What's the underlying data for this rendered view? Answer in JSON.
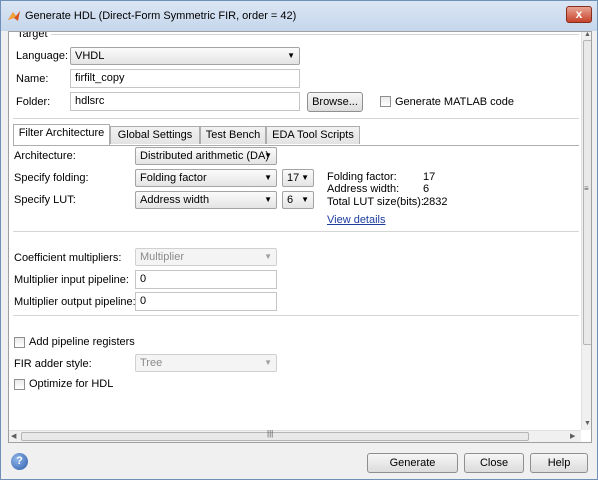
{
  "window": {
    "title": "Generate HDL (Direct-Form Symmetric FIR, order = 42)",
    "close_glyph": "x"
  },
  "target": {
    "group_title": "Target",
    "language_label": "Language:",
    "language_value": "VHDL",
    "name_label": "Name:",
    "name_value": "firfilt_copy",
    "folder_label": "Folder:",
    "folder_value": "hdlsrc",
    "browse_label": "Browse...",
    "generate_matlab_label": "Generate MATLAB code"
  },
  "tabs": [
    {
      "label": "Filter Architecture"
    },
    {
      "label": "Global Settings"
    },
    {
      "label": "Test Bench"
    },
    {
      "label": "EDA Tool Scripts"
    }
  ],
  "architecture": {
    "architecture_label": "Architecture:",
    "architecture_value": "Distributed arithmetic (DA)",
    "folding_label": "Specify folding:",
    "folding_value": "Folding factor",
    "folding_number": "17",
    "lut_label": "Specify LUT:",
    "lut_value": "Address width",
    "lut_number": "6",
    "info_folding_label": "Folding factor:",
    "info_folding_value": "17",
    "info_address_label": "Address width:",
    "info_address_value": "6",
    "info_lut_label": "Total LUT size(bits):",
    "info_lut_value": "2832",
    "view_details": "View details"
  },
  "multipliers": {
    "coeff_label": "Coefficient multipliers:",
    "coeff_value": "Multiplier",
    "input_pipeline_label": "Multiplier input pipeline:",
    "input_pipeline_value": "0",
    "output_pipeline_label": "Multiplier output pipeline:",
    "output_pipeline_value": "0"
  },
  "pipeline": {
    "add_pipeline_label": "Add pipeline registers",
    "adder_style_label": "FIR adder style:",
    "adder_style_value": "Tree",
    "optimize_label": "Optimize for HDL"
  },
  "buttons": {
    "generate": "Generate",
    "close": "Close",
    "help": "Help",
    "help_icon_glyph": "?"
  },
  "icons": {
    "title": "matlab-logo-icon",
    "help": "help-icon"
  }
}
